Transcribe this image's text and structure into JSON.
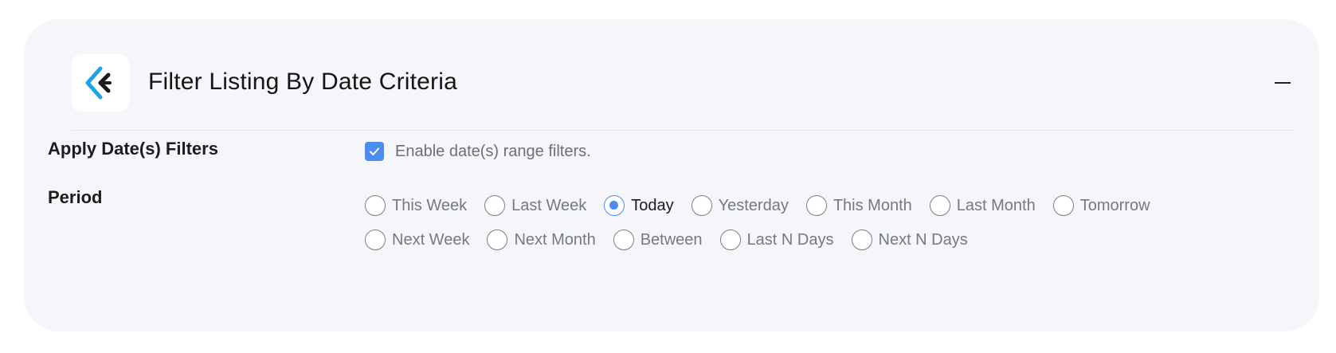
{
  "panel": {
    "title": "Filter Listing By Date Criteria",
    "logo_icon": "jetengine-logo-icon",
    "collapse_icon": "minus-icon"
  },
  "apply_filters": {
    "label": "Apply Date(s) Filters",
    "checkbox_label": "Enable date(s) range filters.",
    "checked": true
  },
  "period": {
    "label": "Period",
    "selected": "Today",
    "row1": [
      {
        "label": "This Week"
      },
      {
        "label": "Last Week"
      },
      {
        "label": "Today"
      },
      {
        "label": "Yesterday"
      },
      {
        "label": "This Month"
      },
      {
        "label": "Last Month"
      },
      {
        "label": "Tomorrow"
      }
    ],
    "row2": [
      {
        "label": "Next Week"
      },
      {
        "label": "Next Month"
      },
      {
        "label": "Between"
      },
      {
        "label": "Last N Days"
      },
      {
        "label": "Next N Days"
      }
    ]
  },
  "colors": {
    "accent": "#4a8cf0",
    "card_bg": "#f5f6fa",
    "logo_blue": "#1fa3e6",
    "logo_dark": "#1b1b1b"
  }
}
